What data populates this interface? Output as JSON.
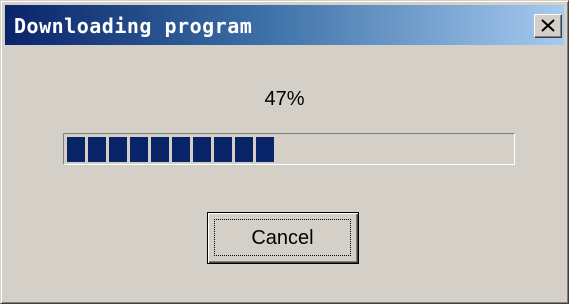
{
  "window": {
    "title": "Downloading program",
    "close_icon": "close-x-icon"
  },
  "progress": {
    "percent_label": "47%",
    "value_percent": 47,
    "fill_color": "#0a246a"
  },
  "buttons": {
    "cancel_label": "Cancel"
  },
  "colors": {
    "dialog_face": "#d4d0c8",
    "title_gradient_start": "#0a246a",
    "title_gradient_end": "#a6caf0"
  }
}
